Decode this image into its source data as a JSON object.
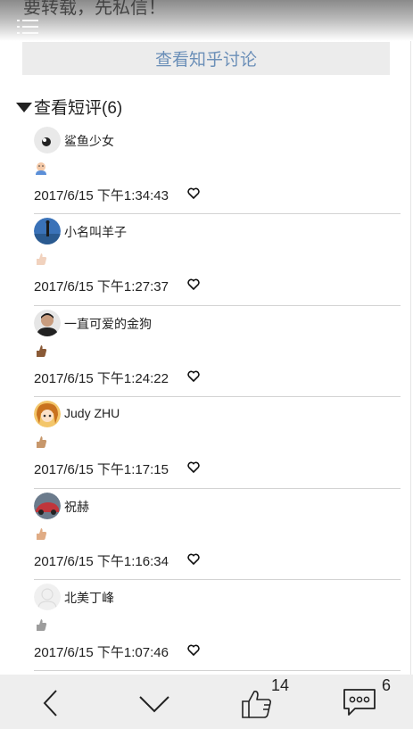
{
  "article": {
    "tail_text": "要转载，先私信！"
  },
  "header": {
    "zhihu_button_label": "查看知乎讨论"
  },
  "comments_section": {
    "title": "查看短评(6)"
  },
  "comments": [
    {
      "user": "鲨鱼少女",
      "avatar_color": "#e9e9e9",
      "reaction": "thumb-light",
      "time": "2017/6/15 下午1:34:43"
    },
    {
      "user": "小名叫羊子",
      "avatar_color": "#3a72b8",
      "reaction": "thumb-pale",
      "time": "2017/6/15 下午1:27:37"
    },
    {
      "user": "一直可爱的金狗",
      "avatar_color": "#3b3b3b",
      "reaction": "thumb-dark",
      "time": "2017/6/15 下午1:24:22"
    },
    {
      "user": "Judy ZHU",
      "avatar_color": "#d99a3a",
      "reaction": "thumb-medium",
      "time": "2017/6/15 下午1:17:15"
    },
    {
      "user": "祝赫",
      "avatar_color": "#c0353b",
      "reaction": "thumb-medium-light",
      "time": "2017/6/15 下午1:16:34"
    },
    {
      "user": "北美丁峰",
      "avatar_color": "#f0f0f0",
      "reaction": "thumb-gray",
      "time": "2017/6/15 下午1:07:46"
    }
  ],
  "bottom_bar": {
    "like_count": "14",
    "comment_count": "6"
  }
}
